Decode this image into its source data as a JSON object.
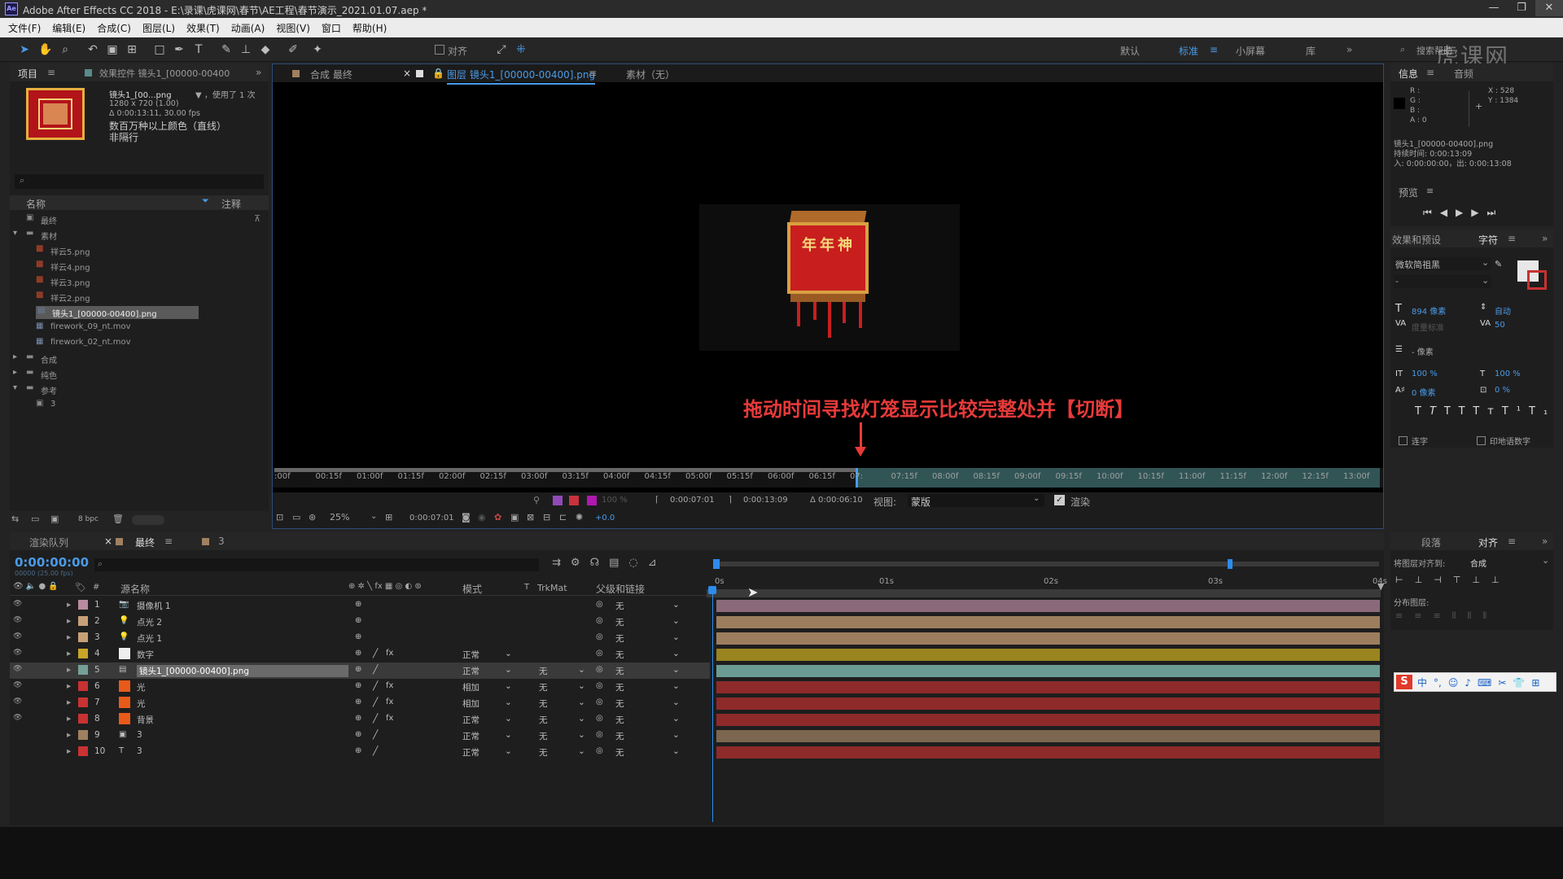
{
  "app": {
    "logo_text": "Ae",
    "title": "Adobe After Effects CC 2018 - E:\\录课\\虎课网\\春节\\AE工程\\春节演示_2021.01.07.aep *"
  },
  "menu": [
    "文件(F)",
    "编辑(E)",
    "合成(C)",
    "图层(L)",
    "效果(T)",
    "动画(A)",
    "视图(V)",
    "窗口",
    "帮助(H)"
  ],
  "toolbar": {
    "align_label": "对齐",
    "workspaces": [
      "默认",
      "标准",
      "小屏幕",
      "库"
    ],
    "search_label": "搜索帮助",
    "watermark": "虎课网"
  },
  "project": {
    "tab_label": "项目",
    "effects_tab": "效果控件 镜头1_[00000-00400",
    "file_name": "镜头1_[00...png",
    "usage": "▼ ，使用了 1 次",
    "dimensions": "1280 x 720 (1.00)",
    "duration": "Δ 0:00:13:11, 30.00 fps",
    "color_info": "数百万种以上颜色（直线）",
    "interlace": "非隔行",
    "search_placeholder": "",
    "col_name": "名称",
    "col_comment": "注释",
    "bpc": "8 bpc",
    "items": [
      {
        "label": "最终",
        "type": "comp",
        "indent": 0
      },
      {
        "label": "素材",
        "type": "folder",
        "indent": 0,
        "open": true
      },
      {
        "label": "祥云5.png",
        "type": "img",
        "indent": 1
      },
      {
        "label": "祥云4.png",
        "type": "img",
        "indent": 1
      },
      {
        "label": "祥云3.png",
        "type": "img",
        "indent": 1
      },
      {
        "label": "祥云2.png",
        "type": "img",
        "indent": 1
      },
      {
        "label": "镜头1_[00000-00400].png",
        "type": "seq",
        "indent": 1,
        "selected": true
      },
      {
        "label": "firework_09_nt.mov",
        "type": "mov",
        "indent": 1
      },
      {
        "label": "firework_02_nt.mov",
        "type": "mov",
        "indent": 1
      },
      {
        "label": "合成",
        "type": "folder",
        "indent": 0
      },
      {
        "label": "纯色",
        "type": "folder",
        "indent": 0
      },
      {
        "label": "参考",
        "type": "folder",
        "indent": 0,
        "open": true
      },
      {
        "label": "3",
        "type": "comp",
        "indent": 1
      }
    ]
  },
  "viewer": {
    "tab_comp": "合成 最终",
    "tab_layer": "图层 镜头1_[00000-00400].png",
    "tab_footage": "素材（无）",
    "annotation": "拖动时间寻找灯笼显示比较完整处并【切断】",
    "lantern_text": "年年神",
    "ruler_ticks": [
      ":00f",
      "00:15f",
      "01:00f",
      "01:15f",
      "02:00f",
      "02:15f",
      "03:00f",
      "03:15f",
      "04:00f",
      "04:15f",
      "05:00f",
      "05:15f",
      "06:00f",
      "06:15f",
      "07:",
      "07:15f",
      "08:00f",
      "08:15f",
      "09:00f",
      "09:15f",
      "10:00f",
      "10:15f",
      "11:00f",
      "11:15f",
      "12:00f",
      "12:15f",
      "13:00f"
    ],
    "playhead_fraction": 0.525,
    "opacity": "100 %",
    "in_time": "0:00:07:01",
    "out_time": "0:00:13:09",
    "delta_time": "Δ 0:00:06:10",
    "view_label": "视图:",
    "view_value": "蒙版",
    "render_label": "渲染",
    "zoom": "25%",
    "current_time": "0:00:07:01",
    "offset": "+0.0"
  },
  "info": {
    "tab_info": "信息",
    "tab_audio": "音频",
    "rgba": [
      "R :",
      "G :",
      "B :",
      "A : 0"
    ],
    "xy": [
      "X : 528",
      "Y : 1384"
    ],
    "file": "镜头1_[00000-00400].png",
    "duration": "持续时间: 0:00:13:09",
    "inout": "入: 0:00:00:00，出: 0:00:13:08",
    "preview": "预览"
  },
  "character": {
    "tab_effects": "效果和预设",
    "tab_char": "字符",
    "font": "微软简祖黑",
    "style": "-",
    "size": "894 像素",
    "leading": "自动",
    "kerning": "度量标准",
    "tracking": "50",
    "indent": "- 像素",
    "vscale": "100 %",
    "hscale": "100 %",
    "baseline": "0 像素",
    "tsume": "0 %",
    "ligature": "连字",
    "hindi": "印地语数字"
  },
  "timeline": {
    "tab_render": "渲染队列",
    "tab_final": "最终",
    "tab_3": "3",
    "timecode": "0:00:00:00",
    "fps": "00000 (25.00 fps)",
    "col_source": "源名称",
    "col_mode": "模式",
    "col_t": "T",
    "col_trkmat": "TrkMat",
    "col_parent": "父级和链接",
    "ruler": [
      "0s",
      "01s",
      "02s",
      "03s",
      "04s"
    ],
    "layers": [
      {
        "num": "1",
        "name": "摄像机 1",
        "label": "#b98aa0",
        "icon": "cam",
        "mode": "",
        "trk": "",
        "parent": "无",
        "bar": "#8a6a7a",
        "fx": false,
        "eye": true
      },
      {
        "num": "2",
        "name": "点光 2",
        "label": "#c8a078",
        "icon": "light",
        "mode": "",
        "trk": "",
        "parent": "无",
        "bar": "#9c7e5e",
        "fx": false,
        "eye": true
      },
      {
        "num": "3",
        "name": "点光 1",
        "label": "#c8a078",
        "icon": "light",
        "mode": "",
        "trk": "",
        "parent": "无",
        "bar": "#9c7e5e",
        "fx": false,
        "eye": true
      },
      {
        "num": "4",
        "name": "数字",
        "label": "#c8a428",
        "icon": "white",
        "mode": "正常",
        "trk": "",
        "parent": "无",
        "bar": "#9a8420",
        "fx": true,
        "eye": true
      },
      {
        "num": "5",
        "name": "镜头1_[00000-00400].png",
        "label": "#74a098",
        "icon": "seq",
        "mode": "正常",
        "trk": "无",
        "parent": "无",
        "bar": "#6a9c94",
        "fx": false,
        "eye": true,
        "selected": true
      },
      {
        "num": "6",
        "name": "光",
        "label": "#c83232",
        "icon": "orange",
        "mode": "相加",
        "trk": "无",
        "parent": "无",
        "bar": "#8e2a2a",
        "fx": true,
        "eye": true
      },
      {
        "num": "7",
        "name": "光",
        "label": "#c83232",
        "icon": "orange",
        "mode": "相加",
        "trk": "无",
        "parent": "无",
        "bar": "#8e2a2a",
        "fx": true,
        "eye": true
      },
      {
        "num": "8",
        "name": "背景",
        "label": "#c83232",
        "icon": "orange",
        "mode": "正常",
        "trk": "无",
        "parent": "无",
        "bar": "#8e2a2a",
        "fx": true,
        "eye": true
      },
      {
        "num": "9",
        "name": "3",
        "label": "#a08060",
        "icon": "comp",
        "mode": "正常",
        "trk": "无",
        "parent": "无",
        "bar": "#7c6650",
        "fx": false,
        "eye": false
      },
      {
        "num": "10",
        "name": "3",
        "label": "#c83232",
        "icon": "text",
        "mode": "正常",
        "trk": "无",
        "parent": "无",
        "bar": "#8e2a2a",
        "fx": false,
        "eye": false
      }
    ]
  },
  "paragraph": {
    "tab_para": "段落",
    "tab_align": "对齐",
    "align_to_label": "将图层对齐到:",
    "align_to_value": "合成",
    "distribute": "分布图层:"
  },
  "ime": {
    "icon": "S",
    "items": [
      "中",
      "°,",
      "☺",
      "♪",
      "⌨",
      "✂",
      "👕",
      "⊞"
    ]
  },
  "colors": {
    "accent": "#2d8ceb",
    "annotation": "#e83a3a",
    "timecode": "#2d8ceb"
  }
}
